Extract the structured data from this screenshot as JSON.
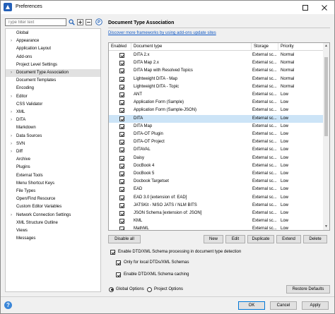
{
  "window": {
    "title": "Preferences"
  },
  "filter": {
    "placeholder": "Type filter text"
  },
  "tree": [
    {
      "label": "Global",
      "arrow": false,
      "selected": false
    },
    {
      "label": "Appearance",
      "arrow": true,
      "selected": false
    },
    {
      "label": "Application Layout",
      "arrow": false,
      "selected": false
    },
    {
      "label": "Add-ons",
      "arrow": false,
      "selected": false
    },
    {
      "label": "Project Level Settings",
      "arrow": false,
      "selected": false
    },
    {
      "label": "Document Type Association",
      "arrow": true,
      "selected": true
    },
    {
      "label": "Document Templates",
      "arrow": false,
      "selected": false
    },
    {
      "label": "Encoding",
      "arrow": false,
      "selected": false
    },
    {
      "label": "Editor",
      "arrow": true,
      "selected": false
    },
    {
      "label": "CSS Validator",
      "arrow": false,
      "selected": false
    },
    {
      "label": "XML",
      "arrow": true,
      "selected": false
    },
    {
      "label": "DITA",
      "arrow": true,
      "selected": false
    },
    {
      "label": "Markdown",
      "arrow": false,
      "selected": false
    },
    {
      "label": "Data Sources",
      "arrow": true,
      "selected": false
    },
    {
      "label": "SVN",
      "arrow": true,
      "selected": false
    },
    {
      "label": "Diff",
      "arrow": true,
      "selected": false
    },
    {
      "label": "Archive",
      "arrow": false,
      "selected": false
    },
    {
      "label": "Plugins",
      "arrow": false,
      "selected": false
    },
    {
      "label": "External Tools",
      "arrow": false,
      "selected": false
    },
    {
      "label": "Menu Shortcut Keys",
      "arrow": false,
      "selected": false
    },
    {
      "label": "File Types",
      "arrow": false,
      "selected": false
    },
    {
      "label": "Open/Find Resource",
      "arrow": false,
      "selected": false
    },
    {
      "label": "Custom Editor Variables",
      "arrow": false,
      "selected": false
    },
    {
      "label": "Network Connection Settings",
      "arrow": true,
      "selected": false
    },
    {
      "label": "XML Structure Outline",
      "arrow": false,
      "selected": false
    },
    {
      "label": "Views",
      "arrow": false,
      "selected": false
    },
    {
      "label": "Messages",
      "arrow": false,
      "selected": false
    }
  ],
  "panel": {
    "title": "Document Type Association",
    "link": "Discover more frameworks by using add-ons update sites"
  },
  "table": {
    "columns": [
      "Enabled",
      "Document type",
      "Storage",
      "Priority"
    ],
    "rows": [
      {
        "name": "DITA 2.x",
        "storage": "External sc...",
        "priority": "Normal",
        "selected": false
      },
      {
        "name": "DITA Map 2.x",
        "storage": "External sc...",
        "priority": "Normal",
        "selected": false
      },
      {
        "name": "DITA Map with Resolved Topics",
        "storage": "External sc...",
        "priority": "Normal",
        "selected": false
      },
      {
        "name": "Lightweight DITA - Map",
        "storage": "External sc...",
        "priority": "Normal",
        "selected": false
      },
      {
        "name": "Lightweight DITA - Topic",
        "storage": "External sc...",
        "priority": "Normal",
        "selected": false
      },
      {
        "name": "ANT",
        "storage": "External sc...",
        "priority": "Low",
        "selected": false
      },
      {
        "name": "Application Form (Sample)",
        "storage": "External sc...",
        "priority": "Low",
        "selected": false
      },
      {
        "name": "Application Form (Sample-JSON)",
        "storage": "External sc...",
        "priority": "Low",
        "selected": false
      },
      {
        "name": "DITA",
        "storage": "External sc...",
        "priority": "Low",
        "selected": true
      },
      {
        "name": "DITA Map",
        "storage": "External sc...",
        "priority": "Low",
        "selected": false
      },
      {
        "name": "DITA-OT Plugin",
        "storage": "External sc...",
        "priority": "Low",
        "selected": false
      },
      {
        "name": "DITA-OT Project",
        "storage": "External sc...",
        "priority": "Low",
        "selected": false
      },
      {
        "name": "DITAVAL",
        "storage": "External sc...",
        "priority": "Low",
        "selected": false
      },
      {
        "name": "Daisy",
        "storage": "External sc...",
        "priority": "Low",
        "selected": false
      },
      {
        "name": "DocBook 4",
        "storage": "External sc...",
        "priority": "Low",
        "selected": false
      },
      {
        "name": "DocBook 5",
        "storage": "External sc...",
        "priority": "Low",
        "selected": false
      },
      {
        "name": "Docbook Targetset",
        "storage": "External sc...",
        "priority": "Low",
        "selected": false
      },
      {
        "name": "EAD",
        "storage": "External sc...",
        "priority": "Low",
        "selected": false
      },
      {
        "name": "EAD 3.0 [extension of: EAD]",
        "storage": "External sc...",
        "priority": "Low",
        "selected": false
      },
      {
        "name": "JATSKit - NISO JATS / NLM BITS",
        "storage": "External sc...",
        "priority": "Low",
        "selected": false
      },
      {
        "name": "JSON Schema [extension of: JSON]",
        "storage": "External sc...",
        "priority": "Low",
        "selected": false
      },
      {
        "name": "KML",
        "storage": "External sc...",
        "priority": "Low",
        "selected": false
      },
      {
        "name": "MathML",
        "storage": "External sc...",
        "priority": "Low",
        "selected": false
      }
    ]
  },
  "buttons": {
    "disable_all": "Disable all",
    "new": "New",
    "edit": "Edit",
    "duplicate": "Duplicate",
    "extend": "Extend",
    "delete": "Delete",
    "restore_defaults": "Restore Defaults",
    "ok": "OK",
    "cancel": "Cancel",
    "apply": "Apply"
  },
  "options": {
    "enable_dtd": "Enable DTD/XML Schema processing in document type detection",
    "only_local": "Only for local DTDs/XML Schemas",
    "enable_caching": "Enable DTD/XML Schema caching",
    "global_options": "Global Options",
    "project_options": "Project Options"
  },
  "colors": {
    "selection": "#cce4f7",
    "link": "#0f58c5",
    "accent": "#0078d7"
  }
}
